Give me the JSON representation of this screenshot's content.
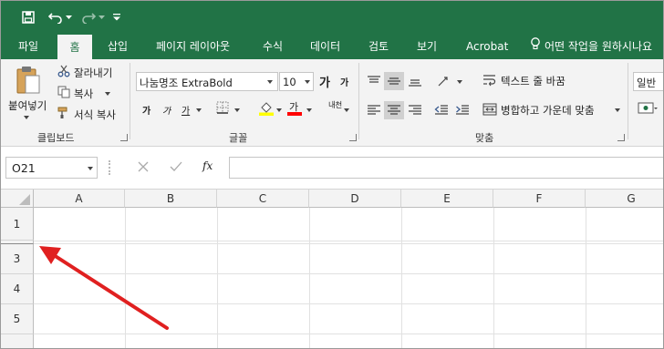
{
  "quick_access": {
    "save_icon": "save-icon",
    "undo_icon": "undo-icon",
    "redo_icon": "redo-icon",
    "customize_icon": "customize-toolbar-icon"
  },
  "tabs": [
    "파일",
    "홈",
    "삽입",
    "페이지 레이아웃",
    "수식",
    "데이터",
    "검토",
    "보기",
    "Acrobat"
  ],
  "active_tab": "홈",
  "tell_me": "어떤 작업을 원하시나요",
  "clipboard": {
    "paste": "붙여넣기",
    "cut": "잘라내기",
    "copy": "복사",
    "format_painter": "서식 복사",
    "label": "클립보드"
  },
  "font": {
    "name": "나눔명조 ExtraBold",
    "size": "10",
    "grow": "가",
    "shrink": "가",
    "bold": "가",
    "italic": "가",
    "underline": "가",
    "font_color_glyph": "가",
    "phonetic": "내천",
    "label": "글꼴",
    "fill_color": "#ffff00",
    "font_color": "#ff0000"
  },
  "alignment": {
    "wrap_text": "텍스트 줄 바꿈",
    "merge_center": "병합하고 가운데 맞춤",
    "label": "맞춤"
  },
  "number": {
    "format": "일반"
  },
  "formula_bar": {
    "name_box": "O21",
    "cancel_icon": "cancel-icon",
    "enter_icon": "enter-icon",
    "fx": "fx",
    "formula": ""
  },
  "grid": {
    "columns": [
      "A",
      "B",
      "C",
      "D",
      "E",
      "F",
      "G"
    ],
    "rows": [
      "1",
      "3",
      "4",
      "5"
    ]
  },
  "annotation": {
    "color": "#e02020"
  },
  "colors": {
    "excel_green": "#217346",
    "ribbon_bg": "#f3f3f3"
  }
}
